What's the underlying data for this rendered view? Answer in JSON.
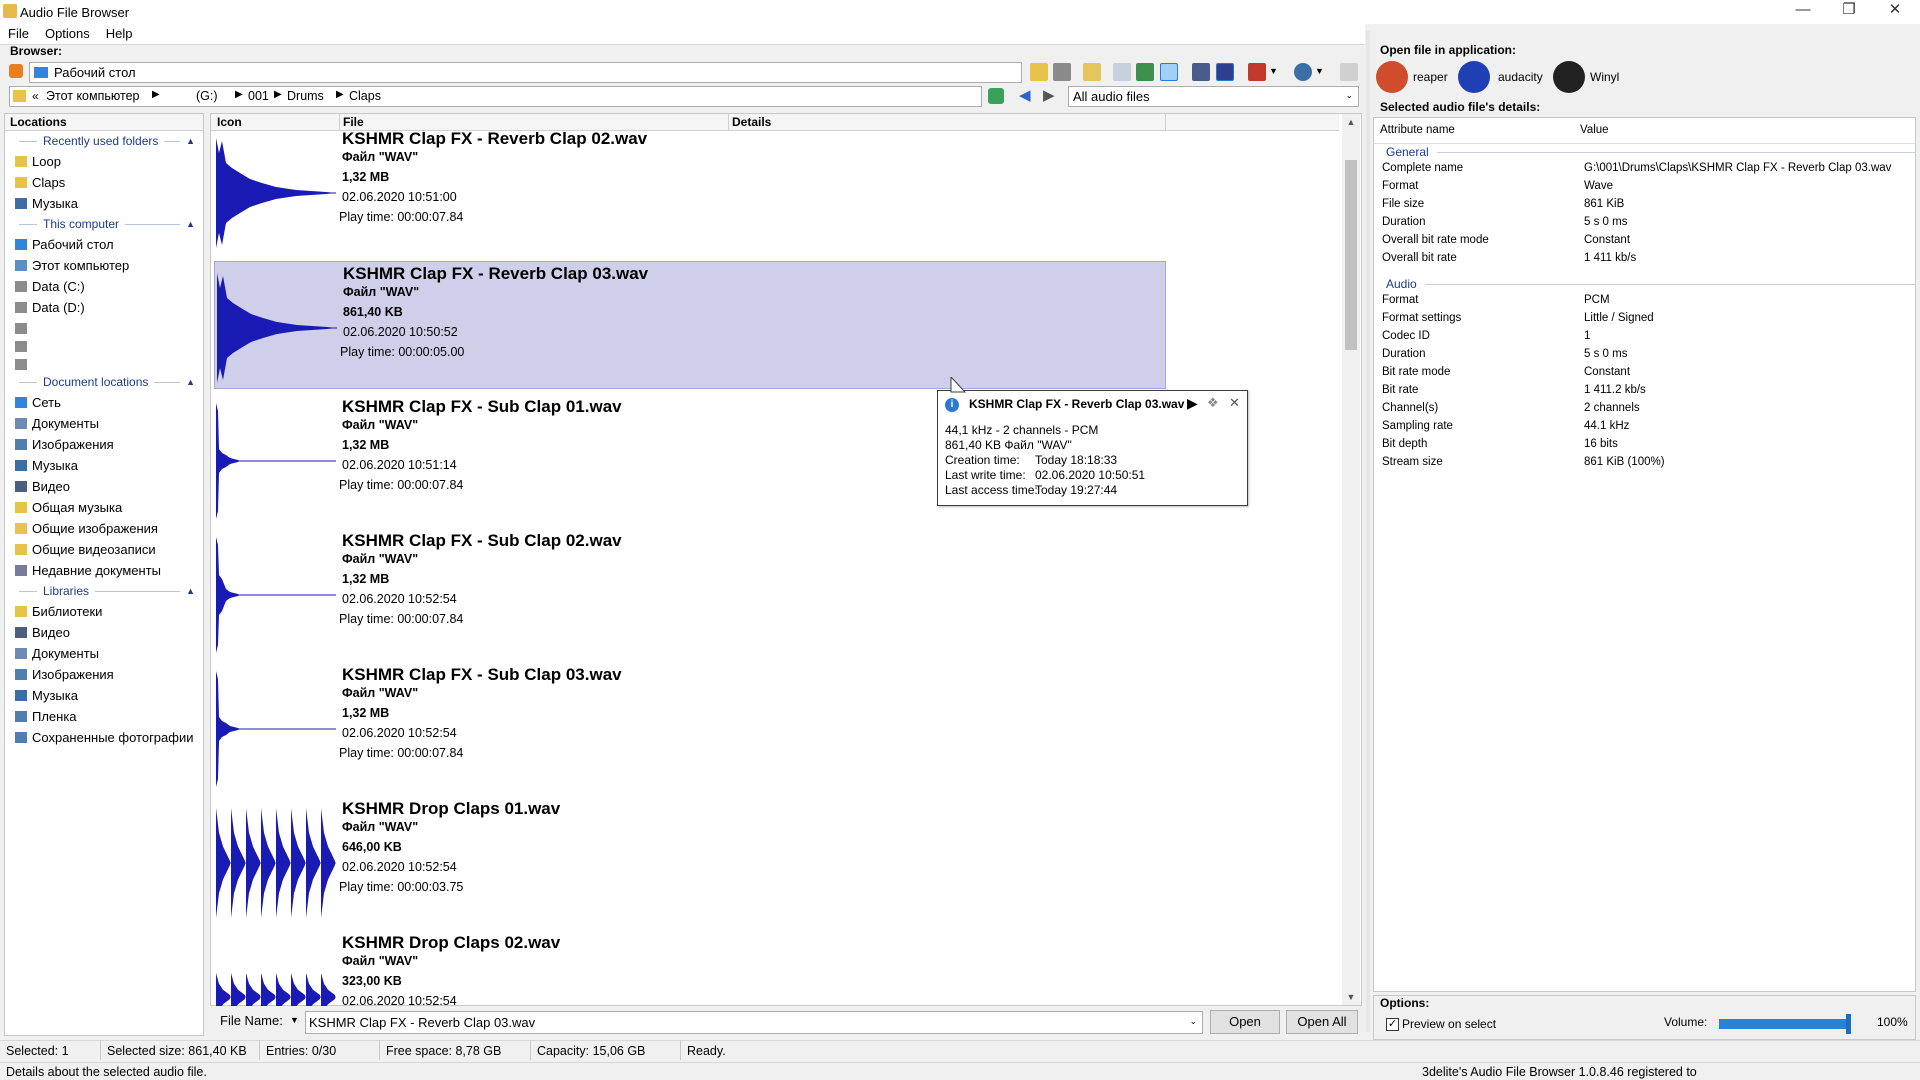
{
  "window": {
    "title": "Audio File Browser",
    "minimize_icon": "minimize-icon",
    "maximize_icon": "maximize-icon",
    "close_icon": "close-icon"
  },
  "menu": [
    "File",
    "Options",
    "Help"
  ],
  "browser": {
    "label": "Browser:",
    "location_value": "Рабочий стол",
    "breadcrumb": [
      "Этот компьютер",
      "(G:)",
      "001",
      "Drums",
      "Claps"
    ],
    "filter_value": "All audio files"
  },
  "locations": {
    "header": "Locations",
    "groups": [
      {
        "title": "Recently used folders",
        "items": [
          {
            "label": "Loop",
            "icon": "folder-icon"
          },
          {
            "label": "Claps",
            "icon": "folder-icon"
          },
          {
            "label": "Музыка",
            "icon": "music-icon"
          }
        ]
      },
      {
        "title": "This computer",
        "items": [
          {
            "label": "Рабочий стол",
            "icon": "desktop-icon"
          },
          {
            "label": "Этот компьютер",
            "icon": "computer-icon"
          },
          {
            "label": "Data (C:)",
            "icon": "drive-icon"
          },
          {
            "label": "Data (D:)",
            "icon": "drive-icon"
          },
          {
            "label": "",
            "icon": "drive-icon"
          },
          {
            "label": "",
            "icon": "drive-icon"
          },
          {
            "label": "",
            "icon": "drive-icon"
          }
        ]
      },
      {
        "title": "Document locations",
        "items": [
          {
            "label": "Сеть",
            "icon": "network-icon"
          },
          {
            "label": "Документы",
            "icon": "documents-icon"
          },
          {
            "label": "Изображения",
            "icon": "pictures-icon"
          },
          {
            "label": "Музыка",
            "icon": "music-icon"
          },
          {
            "label": "Видео",
            "icon": "video-icon"
          },
          {
            "label": "Общая музыка",
            "icon": "folder-icon"
          },
          {
            "label": "Общие изображения",
            "icon": "folder-icon"
          },
          {
            "label": "Общие видеозаписи",
            "icon": "folder-icon"
          },
          {
            "label": "Недавние документы",
            "icon": "recent-icon"
          }
        ]
      },
      {
        "title": "Libraries",
        "items": [
          {
            "label": "Библиотеки",
            "icon": "folder-icon"
          },
          {
            "label": "Видео",
            "icon": "video-icon"
          },
          {
            "label": "Документы",
            "icon": "documents-icon"
          },
          {
            "label": "Изображения",
            "icon": "pictures-icon"
          },
          {
            "label": "Музыка",
            "icon": "music-icon"
          },
          {
            "label": "Пленка",
            "icon": "pictures-icon"
          },
          {
            "label": "Сохраненные фотографии",
            "icon": "pictures-icon"
          }
        ]
      }
    ]
  },
  "list": {
    "columns": [
      "Icon",
      "File",
      "Details"
    ],
    "entries": [
      {
        "name": "KSHMR Clap FX - Reverb Clap 02.wav",
        "type": "Файл \"WAV\"",
        "size": "1,32 MB",
        "date": "02.06.2020 10:51:00",
        "play": "Play time: 00:00:07.84",
        "wave": "reverb",
        "selected": false
      },
      {
        "name": "KSHMR Clap FX - Reverb Clap 03.wav",
        "type": "Файл \"WAV\"",
        "size": "861,40 KB",
        "date": "02.06.2020 10:50:52",
        "play": "Play time: 00:00:05.00",
        "wave": "reverb",
        "selected": true
      },
      {
        "name": "KSHMR Clap FX - Sub Clap 01.wav",
        "type": "Файл \"WAV\"",
        "size": "1,32 MB",
        "date": "02.06.2020 10:51:14",
        "play": "Play time: 00:00:07.84",
        "wave": "sub",
        "selected": false
      },
      {
        "name": "KSHMR Clap FX - Sub Clap 02.wav",
        "type": "Файл \"WAV\"",
        "size": "1,32 MB",
        "date": "02.06.2020 10:52:54",
        "play": "Play time: 00:00:07.84",
        "wave": "sub2",
        "selected": false
      },
      {
        "name": "KSHMR Clap FX - Sub Clap 03.wav",
        "type": "Файл \"WAV\"",
        "size": "1,32 MB",
        "date": "02.06.2020 10:52:54",
        "play": "Play time: 00:00:07.84",
        "wave": "sub",
        "selected": false
      },
      {
        "name": "KSHMR Drop Claps 01.wav",
        "type": "Файл \"WAV\"",
        "size": "646,00 KB",
        "date": "02.06.2020 10:52:54",
        "play": "Play time: 00:00:03.75",
        "wave": "drop",
        "selected": false
      },
      {
        "name": "KSHMR Drop Claps 02.wav",
        "type": "Файл \"WAV\"",
        "size": "323,00 KB",
        "date": "02.06.2020 10:52:54",
        "play": "",
        "wave": "drop2",
        "selected": false
      }
    ]
  },
  "tooltip": {
    "title": "KSHMR Clap FX - Reverb Clap 03.wav",
    "lines": [
      "44,1 kHz - 2 channels - PCM",
      "861,40 KB Файл \"WAV\""
    ],
    "kv": [
      {
        "k": "Creation time:",
        "v": "Today 18:18:33"
      },
      {
        "k": "Last write time:",
        "v": "02.06.2020 10:50:51"
      },
      {
        "k": "Last access time:",
        "v": "Today 19:27:44"
      }
    ]
  },
  "bottom": {
    "file_name_label": "File Name:",
    "file_name_value": "KSHMR Clap FX - Reverb Clap 03.wav",
    "open": "Open",
    "open_all": "Open All"
  },
  "apps": {
    "label": "Open file in application:",
    "items": [
      {
        "label": "reaper",
        "color": "#d14b2d"
      },
      {
        "label": "audacity",
        "color": "#1f3fb5"
      },
      {
        "label": "Winyl",
        "color": "#222222"
      }
    ]
  },
  "details": {
    "label": "Selected audio file's details:",
    "headers": [
      "Attribute name",
      "Value"
    ],
    "general_title": "General",
    "general": [
      {
        "k": "Complete name",
        "v": "G:\\001\\Drums\\Claps\\KSHMR Clap FX - Reverb Clap 03.wav"
      },
      {
        "k": "Format",
        "v": "Wave"
      },
      {
        "k": "File size",
        "v": "861 KiB"
      },
      {
        "k": "Duration",
        "v": "5 s 0 ms"
      },
      {
        "k": "Overall bit rate mode",
        "v": "Constant"
      },
      {
        "k": "Overall bit rate",
        "v": "1 411 kb/s"
      }
    ],
    "audio_title": "Audio",
    "audio": [
      {
        "k": "Format",
        "v": "PCM"
      },
      {
        "k": "Format settings",
        "v": "Little / Signed"
      },
      {
        "k": "Codec ID",
        "v": "1"
      },
      {
        "k": "Duration",
        "v": "5 s 0 ms"
      },
      {
        "k": "Bit rate mode",
        "v": "Constant"
      },
      {
        "k": "Bit rate",
        "v": "1 411.2 kb/s"
      },
      {
        "k": "Channel(s)",
        "v": "2 channels"
      },
      {
        "k": "Sampling rate",
        "v": "44.1 kHz"
      },
      {
        "k": "Bit depth",
        "v": "16 bits"
      },
      {
        "k": "Stream size",
        "v": "861 KiB (100%)"
      }
    ]
  },
  "options": {
    "label": "Options:",
    "preview": "Preview on select",
    "preview_checked": true,
    "volume_label": "Volume:",
    "volume_percent": 100,
    "volume_text": "100%"
  },
  "status": {
    "selected": "Selected: 1",
    "selected_size": "Selected size: 861,40 KB",
    "entries": "Entries: 0/30",
    "free": "Free space: 8,78 GB",
    "capacity": "Capacity: 15,06 GB",
    "state": "Ready.",
    "hint": "Details about the selected audio file.",
    "registered": "3delite's Audio File Browser 1.0.8.46 registered to"
  },
  "colors": {
    "wave": "#1a1ab4",
    "selection": "#cfcfe9",
    "accent": "#1e3a8a"
  }
}
